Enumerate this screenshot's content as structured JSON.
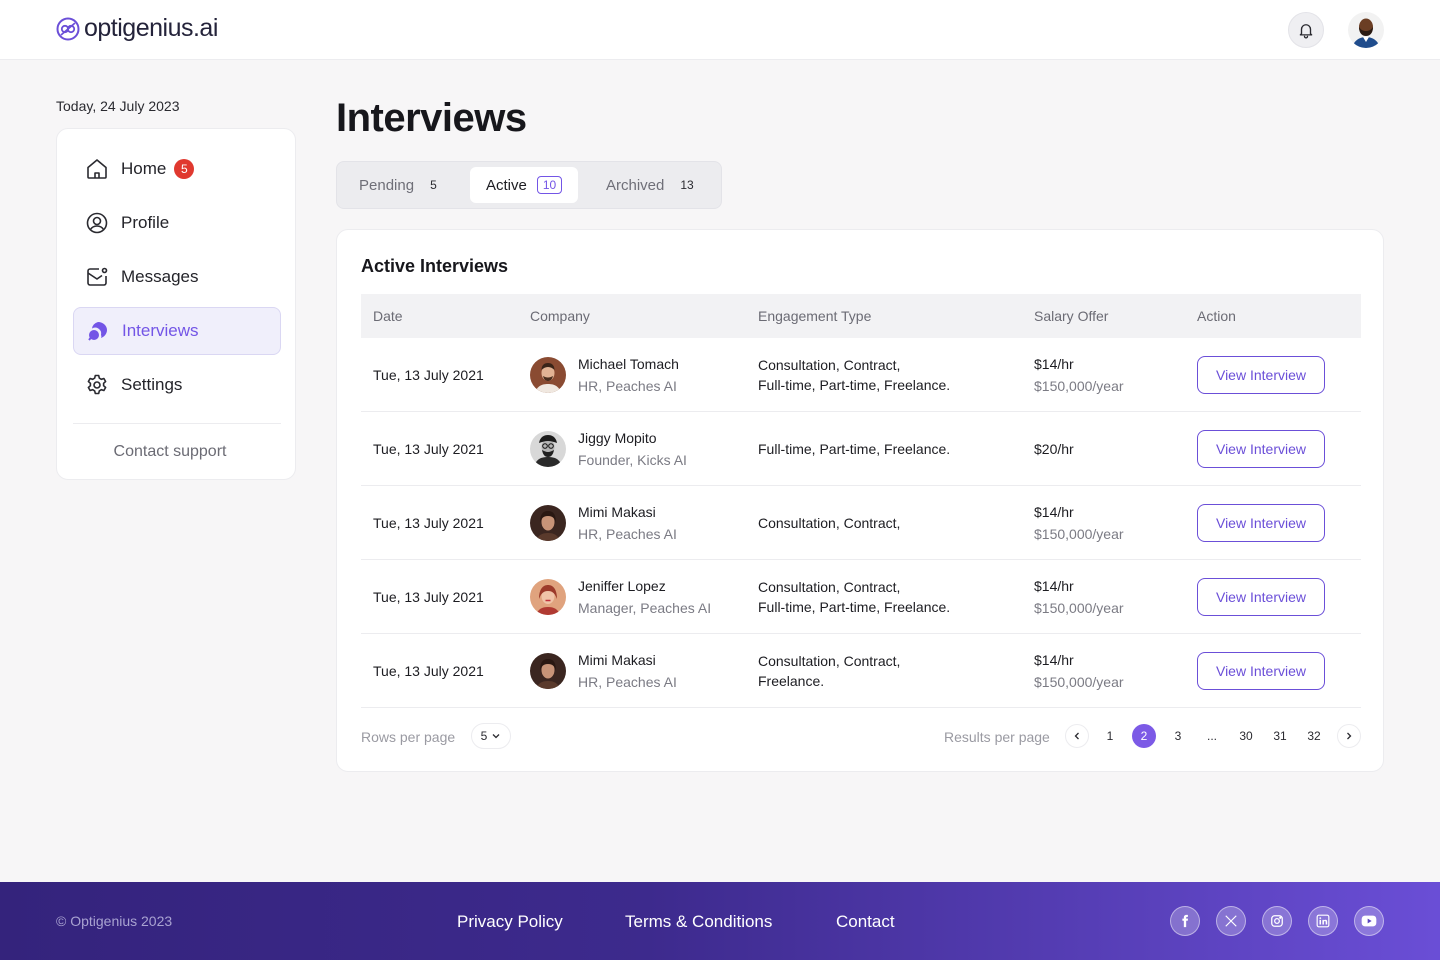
{
  "header": {
    "logo_text": "optigenius.ai"
  },
  "sidebar": {
    "today": "Today, 24 July 2023",
    "items": [
      {
        "label": "Home",
        "icon": "home-icon",
        "badge": "5"
      },
      {
        "label": "Profile",
        "icon": "user-circle-icon"
      },
      {
        "label": "Messages",
        "icon": "message-icon"
      },
      {
        "label": "Interviews",
        "icon": "chat-bubbles-icon",
        "active": true
      },
      {
        "label": "Settings",
        "icon": "gear-icon"
      }
    ],
    "contact_support": "Contact support"
  },
  "main": {
    "title": "Interviews",
    "tabs": [
      {
        "label": "Pending",
        "count": "5"
      },
      {
        "label": "Active",
        "count": "10",
        "active": true
      },
      {
        "label": "Archived",
        "count": "13"
      }
    ],
    "card_title": "Active Interviews",
    "columns": [
      "Date",
      "Company",
      "Engagement Type",
      "Salary Offer",
      "Action"
    ],
    "rows": [
      {
        "date": "Tue, 13 July 2021",
        "name": "Michael Tomach",
        "role": "HR, Peaches AI",
        "engagement": [
          "Consultation, Contract,",
          "Full-time, Part-time, Freelance."
        ],
        "salary": [
          "$14/hr",
          "$150,000/year"
        ],
        "action": "View Interview"
      },
      {
        "date": "Tue, 13 July 2021",
        "name": "Jiggy Mopito",
        "role": "Founder, Kicks AI",
        "engagement": [
          "Full-time, Part-time, Freelance."
        ],
        "salary": [
          "$20/hr"
        ],
        "action": "View Interview"
      },
      {
        "date": "Tue, 13 July 2021",
        "name": "Mimi Makasi",
        "role": "HR, Peaches AI",
        "engagement": [
          "Consultation, Contract,"
        ],
        "salary": [
          "$14/hr",
          "$150,000/year"
        ],
        "action": "View Interview"
      },
      {
        "date": "Tue, 13 July 2021",
        "name": "Jeniffer Lopez",
        "role": "Manager, Peaches AI",
        "engagement": [
          "Consultation, Contract,",
          "Full-time, Part-time, Freelance."
        ],
        "salary": [
          "$14/hr",
          "$150,000/year"
        ],
        "action": "View Interview"
      },
      {
        "date": "Tue, 13 July 2021",
        "name": "Mimi Makasi",
        "role": "HR, Peaches AI",
        "engagement": [
          "Consultation, Contract,",
          "Freelance."
        ],
        "salary": [
          "$14/hr",
          "$150,000/year"
        ],
        "action": "View Interview"
      }
    ],
    "pagination": {
      "rows_label": "Rows per page",
      "rows_value": "5",
      "results_label": "Results per page",
      "pages": [
        "1",
        "2",
        "3",
        "...",
        "30",
        "31",
        "32"
      ],
      "current": "2"
    }
  },
  "footer": {
    "copyright": "© Optigenius 2023",
    "links": [
      "Privacy Policy",
      "Terms & Conditions",
      "Contact"
    ],
    "social": [
      "facebook-icon",
      "x-icon",
      "instagram-icon",
      "linkedin-icon",
      "youtube-icon"
    ]
  },
  "colors": {
    "accent": "#7355e6",
    "badge": "#e0392f",
    "footer_start": "#34237c",
    "footer_end": "#6a4ed6"
  }
}
